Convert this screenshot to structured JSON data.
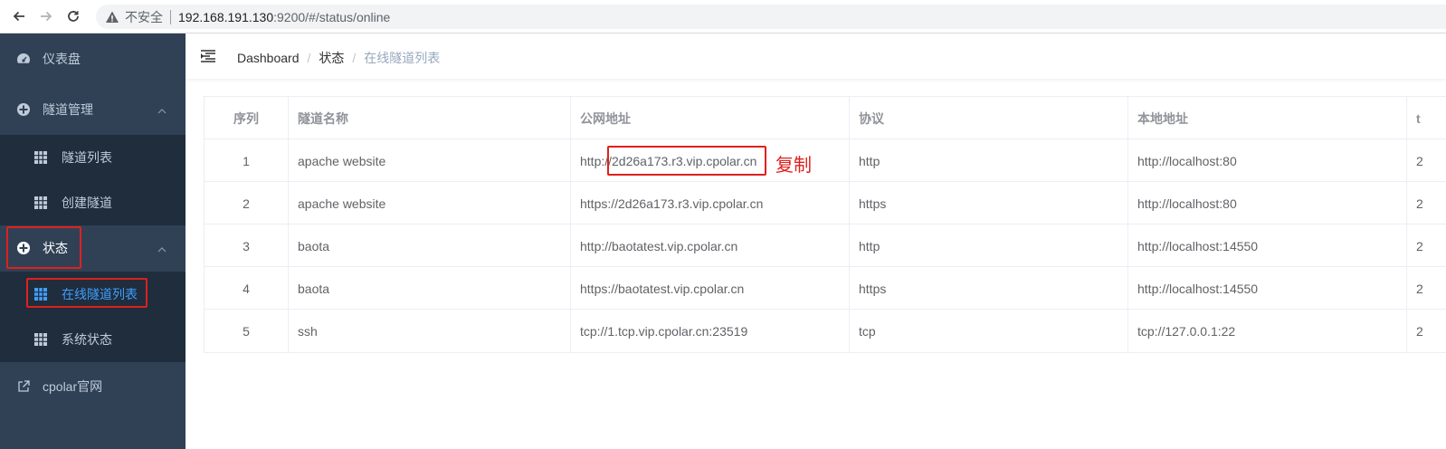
{
  "browser": {
    "insecure_label": "不安全",
    "url_host": "192.168.191.130",
    "url_rest": ":9200/#/status/online"
  },
  "sidebar": {
    "items": [
      {
        "label": "仪表盘",
        "icon": "dashboard-icon"
      },
      {
        "label": "隧道管理",
        "icon": "circle-plus-icon"
      },
      {
        "label": "隧道列表",
        "icon": "grid-icon"
      },
      {
        "label": "创建隧道",
        "icon": "grid-icon"
      },
      {
        "label": "状态",
        "icon": "circle-plus-icon"
      },
      {
        "label": "在线隧道列表",
        "icon": "grid-icon"
      },
      {
        "label": "系统状态",
        "icon": "grid-icon"
      },
      {
        "label": "cpolar官网",
        "icon": "external-link-icon"
      }
    ],
    "active_color": "#409eff",
    "background": "#304156"
  },
  "breadcrumb": {
    "items": [
      "Dashboard",
      "状态",
      "在线隧道列表"
    ],
    "separator": "/"
  },
  "table": {
    "headers": [
      "序列",
      "隧道名称",
      "公网地址",
      "协议",
      "本地地址",
      "t"
    ],
    "rows": [
      {
        "idx": "1",
        "name": "apache website",
        "public": "http://2d26a173.r3.vip.cpolar.cn",
        "proto": "http",
        "local": "http://localhost:80",
        "extra": "2"
      },
      {
        "idx": "2",
        "name": "apache website",
        "public": "https://2d26a173.r3.vip.cpolar.cn",
        "proto": "https",
        "local": "http://localhost:80",
        "extra": "2"
      },
      {
        "idx": "3",
        "name": "baota",
        "public": "http://baotatest.vip.cpolar.cn",
        "proto": "http",
        "local": "http://localhost:14550",
        "extra": "2"
      },
      {
        "idx": "4",
        "name": "baota",
        "public": "https://baotatest.vip.cpolar.cn",
        "proto": "https",
        "local": "http://localhost:14550",
        "extra": "2"
      },
      {
        "idx": "5",
        "name": "ssh",
        "public": "tcp://1.tcp.vip.cpolar.cn:23519",
        "proto": "tcp",
        "local": "tcp://127.0.0.1:22",
        "extra": "2"
      }
    ]
  },
  "annotation": {
    "copy_note": "复制",
    "color": "#e0201c"
  }
}
